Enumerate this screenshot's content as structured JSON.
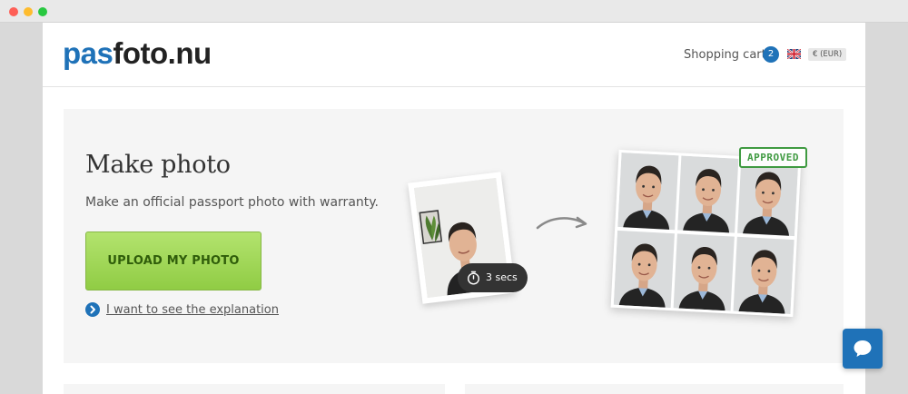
{
  "window": {
    "controls": [
      "close",
      "minimize",
      "maximize"
    ]
  },
  "header": {
    "logo_part1": "pas",
    "logo_part2": "foto.nu",
    "cart_label": "Shopping cart",
    "cart_count": "2",
    "language_flag": "uk-flag-icon",
    "currency": "€ (EUR)"
  },
  "hero": {
    "title": "Make photo",
    "subtitle": "Make an official passport photo with warranty.",
    "upload_button": "UPLOAD MY PHOTO",
    "explanation_link": "I want to see the explanation",
    "timer": "3 secs",
    "stamp": "APPROVED"
  },
  "colors": {
    "brand_blue": "#1f72b8",
    "button_green": "#9ed657",
    "stamp_green": "#3f9a41"
  },
  "icons": {
    "explanation": "chevron-right-icon",
    "timer": "stopwatch-icon",
    "flow": "curved-arrow-icon",
    "chat": "chat-bubble-icon"
  }
}
